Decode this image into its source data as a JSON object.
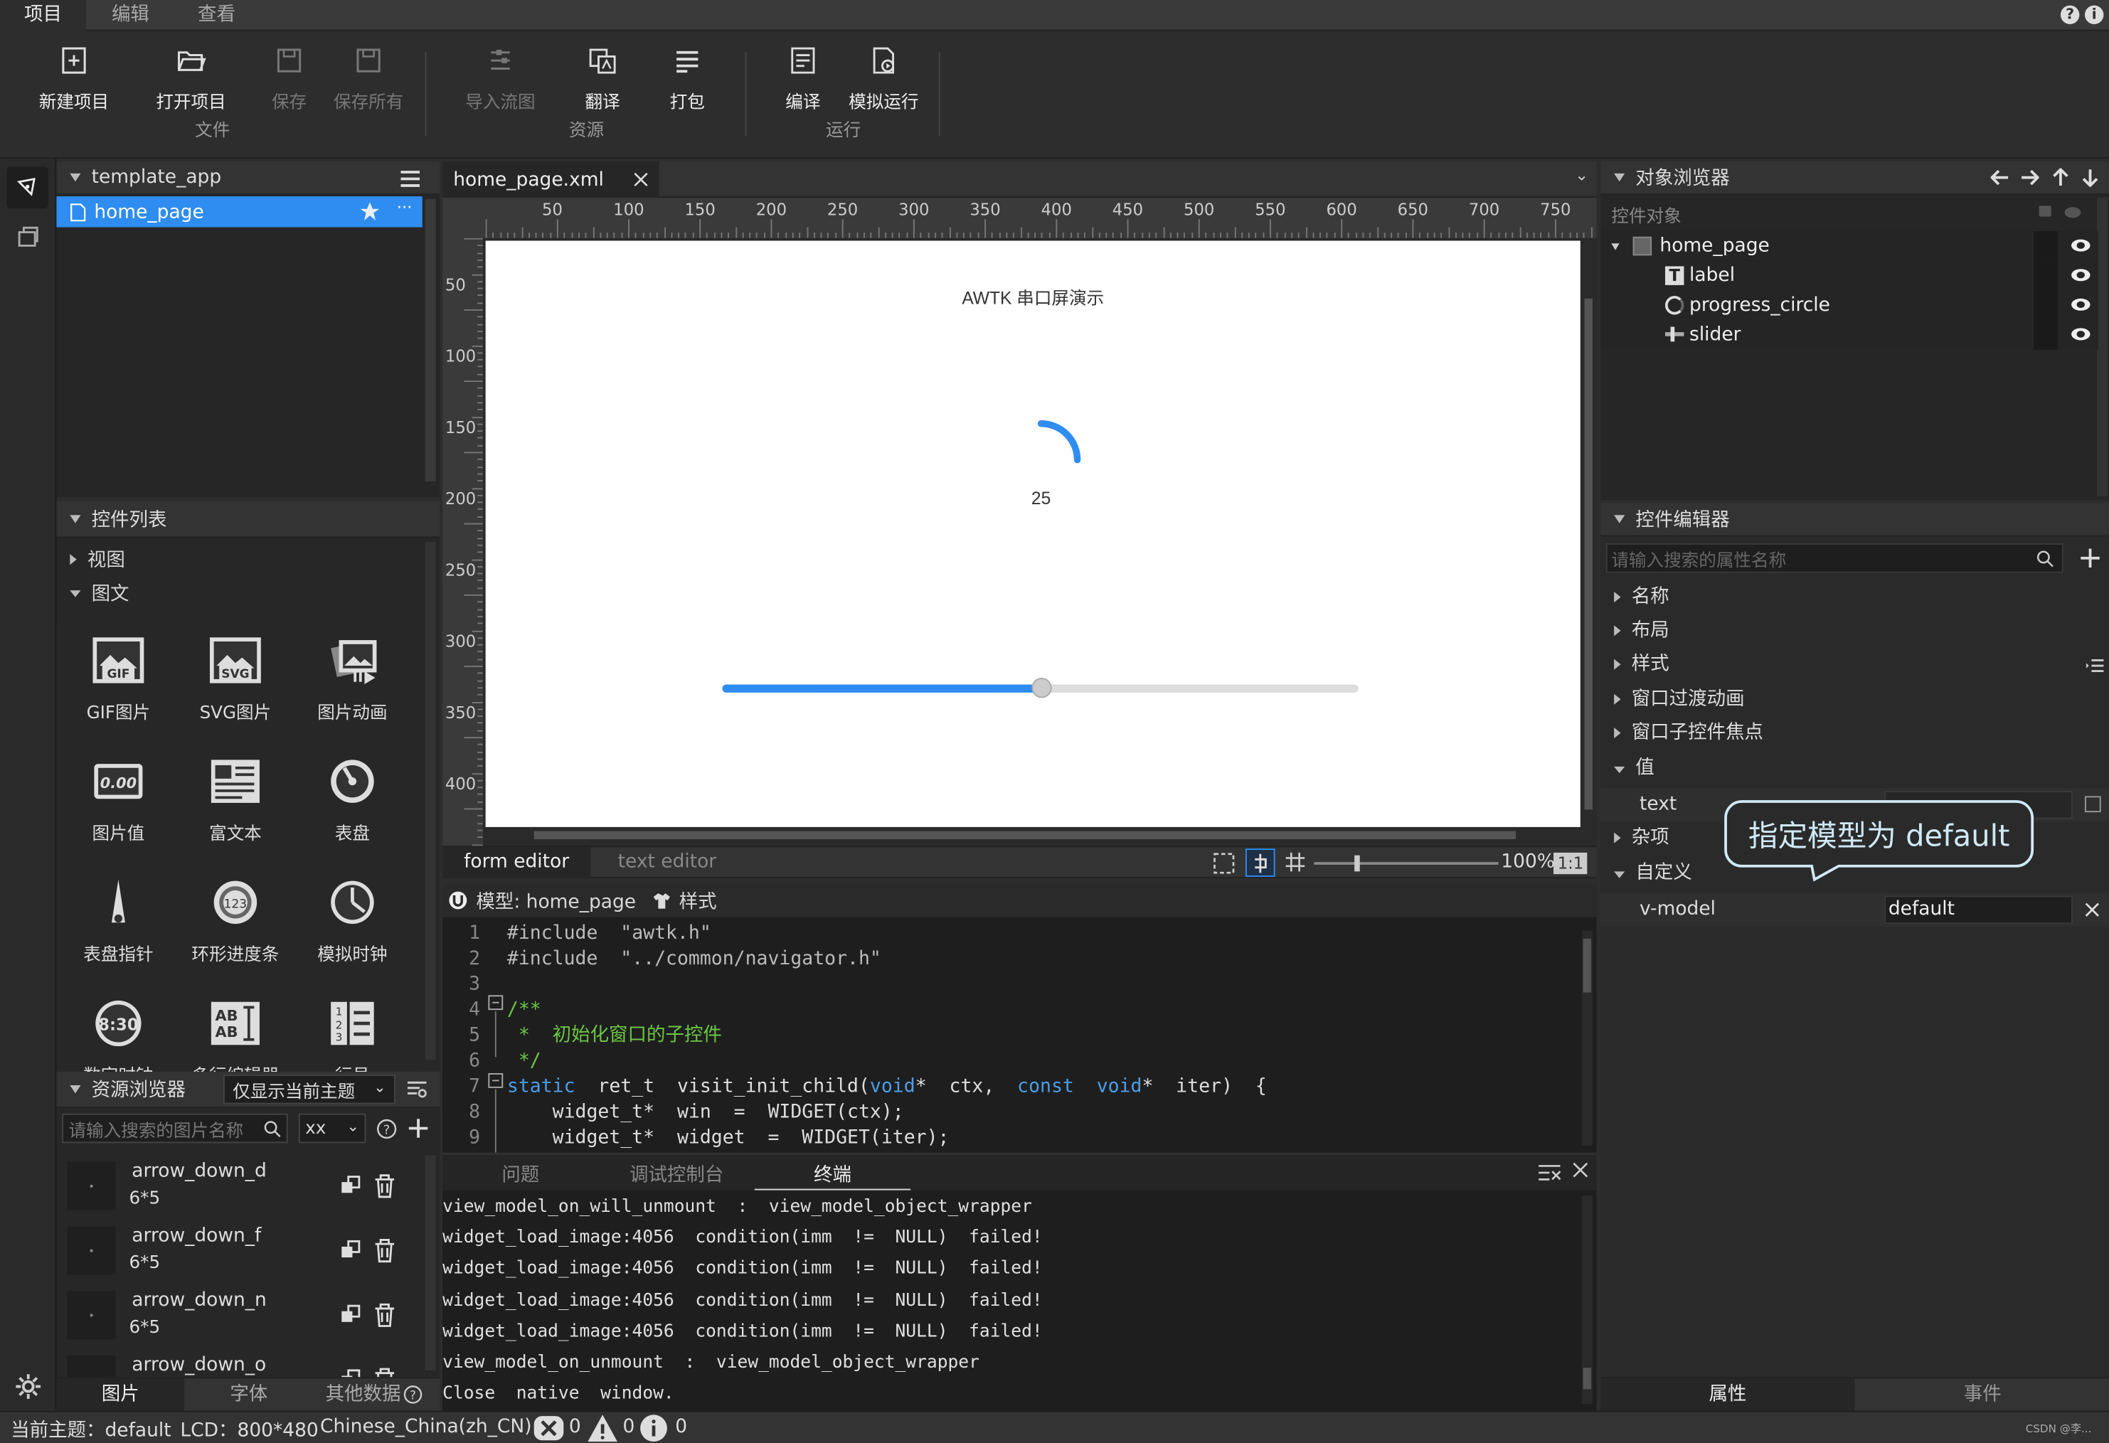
{
  "menubar": {
    "tabs": [
      "项目",
      "编辑",
      "查看"
    ],
    "help": "?",
    "info": "i"
  },
  "ribbon": {
    "new_project": "新建项目",
    "open_project": "打开项目",
    "save": "保存",
    "save_all": "保存所有",
    "group_file": "文件",
    "import_flow": "导入流图",
    "translate": "翻译",
    "pack": "打包",
    "group_resource": "资源",
    "compile": "编译",
    "simulate": "模拟运行",
    "group_run": "运行"
  },
  "project_tree": {
    "root": "template_app",
    "item": "home_page",
    "more": "···"
  },
  "widget_list": {
    "title": "控件列表",
    "cat_view": "视图",
    "cat_image_text": "图文",
    "items": [
      "GIF图片",
      "SVG图片",
      "图片动画",
      "图片值",
      "富文本",
      "表盘",
      "表盘指针",
      "环形进度条",
      "模拟时钟",
      "数字时钟",
      "多行编辑器",
      "行号"
    ],
    "badges": {
      "gif": "GIF",
      "svg": "SVG",
      "val": "0.00",
      "ring": "123",
      "clock": "8:30"
    }
  },
  "resource_browser": {
    "title": "资源浏览器",
    "filter": "仅显示当前主题",
    "search_placeholder": "请输入搜索的图片名称",
    "size_select": "xx",
    "items": [
      {
        "name": "arrow_down_d",
        "size": "6*5"
      },
      {
        "name": "arrow_down_f",
        "size": "6*5"
      },
      {
        "name": "arrow_down_n",
        "size": "6*5"
      },
      {
        "name": "arrow_down_o",
        "size": ""
      }
    ],
    "tabs": [
      "图片",
      "字体",
      "其他数据"
    ]
  },
  "editor": {
    "file_tab": "home_page.xml",
    "form_editor": "form  editor",
    "text_editor": "text  editor",
    "zoom": "100%",
    "zoom_reset": "1:1",
    "ruler_h": [
      "50",
      "100",
      "150",
      "200",
      "250",
      "300",
      "350",
      "400",
      "450",
      "500",
      "550",
      "600",
      "650",
      "700",
      "750"
    ],
    "ruler_v": [
      "50",
      "100",
      "150",
      "200",
      "250",
      "300",
      "350",
      "400"
    ]
  },
  "design_canvas": {
    "title": "AWTK 串口屏演示",
    "progress_value": "25",
    "progress_fraction": 0.25,
    "slider_fraction": 0.5,
    "accent": "#2f8cf0"
  },
  "model_bar": {
    "model": "模型: home_page",
    "style": "样式"
  },
  "code": [
    {
      "n": "1",
      "t": "#include  \"awtk.h\""
    },
    {
      "n": "2",
      "t": "#include  \"../common/navigator.h\""
    },
    {
      "n": "3",
      "t": ""
    },
    {
      "n": "4",
      "t": "/**"
    },
    {
      "n": "5",
      "t": " *  初始化窗口的子控件"
    },
    {
      "n": "6",
      "t": " */"
    },
    {
      "n": "7",
      "t": "static  ret_t  visit_init_child(void*  ctx,  const  void*  iter)  {"
    },
    {
      "n": "8",
      "t": "    widget_t*  win  =  WIDGET(ctx);"
    },
    {
      "n": "9",
      "t": "    widget_t*  widget  =  WIDGET(iter);"
    }
  ],
  "output": {
    "tabs": [
      "问题",
      "调试控制台",
      "终端"
    ],
    "lines": [
      "view_model_on_will_unmount  :  view_model_object_wrapper",
      "widget_load_image:4056  condition(imm  !=  NULL)  failed!",
      "widget_load_image:4056  condition(imm  !=  NULL)  failed!",
      "widget_load_image:4056  condition(imm  !=  NULL)  failed!",
      "widget_load_image:4056  condition(imm  !=  NULL)  failed!",
      "view_model_on_unmount  :  view_model_object_wrapper",
      "Close  native  window."
    ]
  },
  "object_browser": {
    "title": "对象浏览器",
    "header": "控件对象",
    "items": [
      {
        "name": "home_page"
      },
      {
        "name": "label"
      },
      {
        "name": "progress_circle"
      },
      {
        "name": "slider"
      }
    ]
  },
  "widget_editor": {
    "title": "控件编辑器",
    "search_placeholder": "请输入搜索的属性名称",
    "groups": [
      "名称",
      "布局",
      "样式",
      "窗口过渡动画",
      "窗口子控件焦点",
      "值",
      "杂项",
      "自定义"
    ],
    "text_label": "text",
    "vmodel_label": "v-model",
    "vmodel_value": "default",
    "callout": "指定模型为 default",
    "tabs": [
      "属性",
      "事件"
    ]
  },
  "statusbar": {
    "theme": "当前主题：default",
    "lcd": "LCD：800*480",
    "locale": "Chinese_China(zh_CN)",
    "errors": "0",
    "warnings": "0",
    "infos": "0",
    "watermark": "CSDN @李..."
  }
}
